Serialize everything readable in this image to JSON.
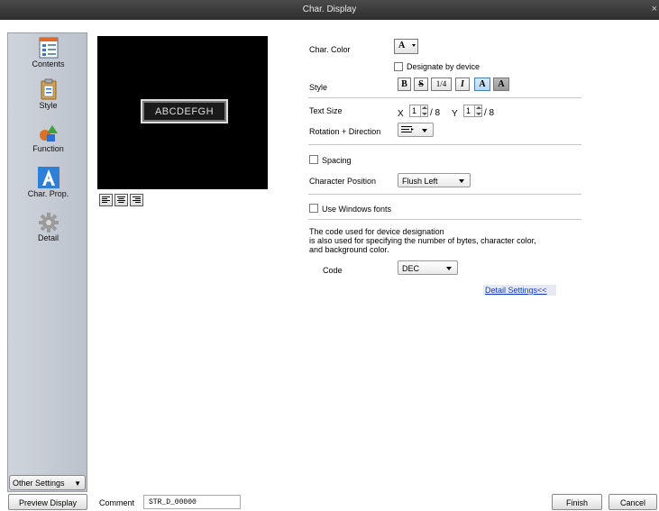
{
  "window": {
    "title": "Char. Display",
    "close_glyph": "×"
  },
  "sidebar": {
    "items": [
      {
        "label": "Contents",
        "icon": "contents-icon"
      },
      {
        "label": "Style",
        "icon": "style-icon"
      },
      {
        "label": "Function",
        "icon": "function-icon"
      },
      {
        "label": "Char. Prop.",
        "icon": "char-prop-icon"
      },
      {
        "label": "Detail",
        "icon": "detail-icon"
      }
    ],
    "other_settings": "Other Settings"
  },
  "preview": {
    "text": "ABCDEFGH"
  },
  "props": {
    "char_color_label": "Char. Color",
    "char_color_value": "A",
    "designate_by_device": "Designate by device",
    "style_label": "Style",
    "style_buttons": [
      "B",
      "S",
      "1/4",
      "I",
      "A",
      "A"
    ],
    "text_size_label": "Text Size",
    "x_label": "X",
    "x_value": "1",
    "x_denominator": "/ 8",
    "y_label": "Y",
    "y_value": "1",
    "y_denominator": "/ 8",
    "rotation_label": "Rotation + Direction",
    "spacing_label": "Spacing",
    "char_position_label": "Character Position",
    "char_position_value": "Flush Left",
    "windows_fonts_label": "Use Windows fonts",
    "code_note_1": "The code used for device designation",
    "code_note_2": " is also used for specifying the number of bytes, character color,",
    "code_note_3": "and background color.",
    "code_label": "Code",
    "code_value": "DEC",
    "detail_settings_link": "Detail Settings<<"
  },
  "footer": {
    "preview_display": "Preview Display",
    "comment_label": "Comment",
    "comment_value": "STR_D_00000",
    "finish": "Finish",
    "cancel": "Cancel"
  },
  "colors": {
    "accent": "#4a7fb5",
    "link": "#1a3cc2",
    "titlebar": "#3a3a3a"
  }
}
